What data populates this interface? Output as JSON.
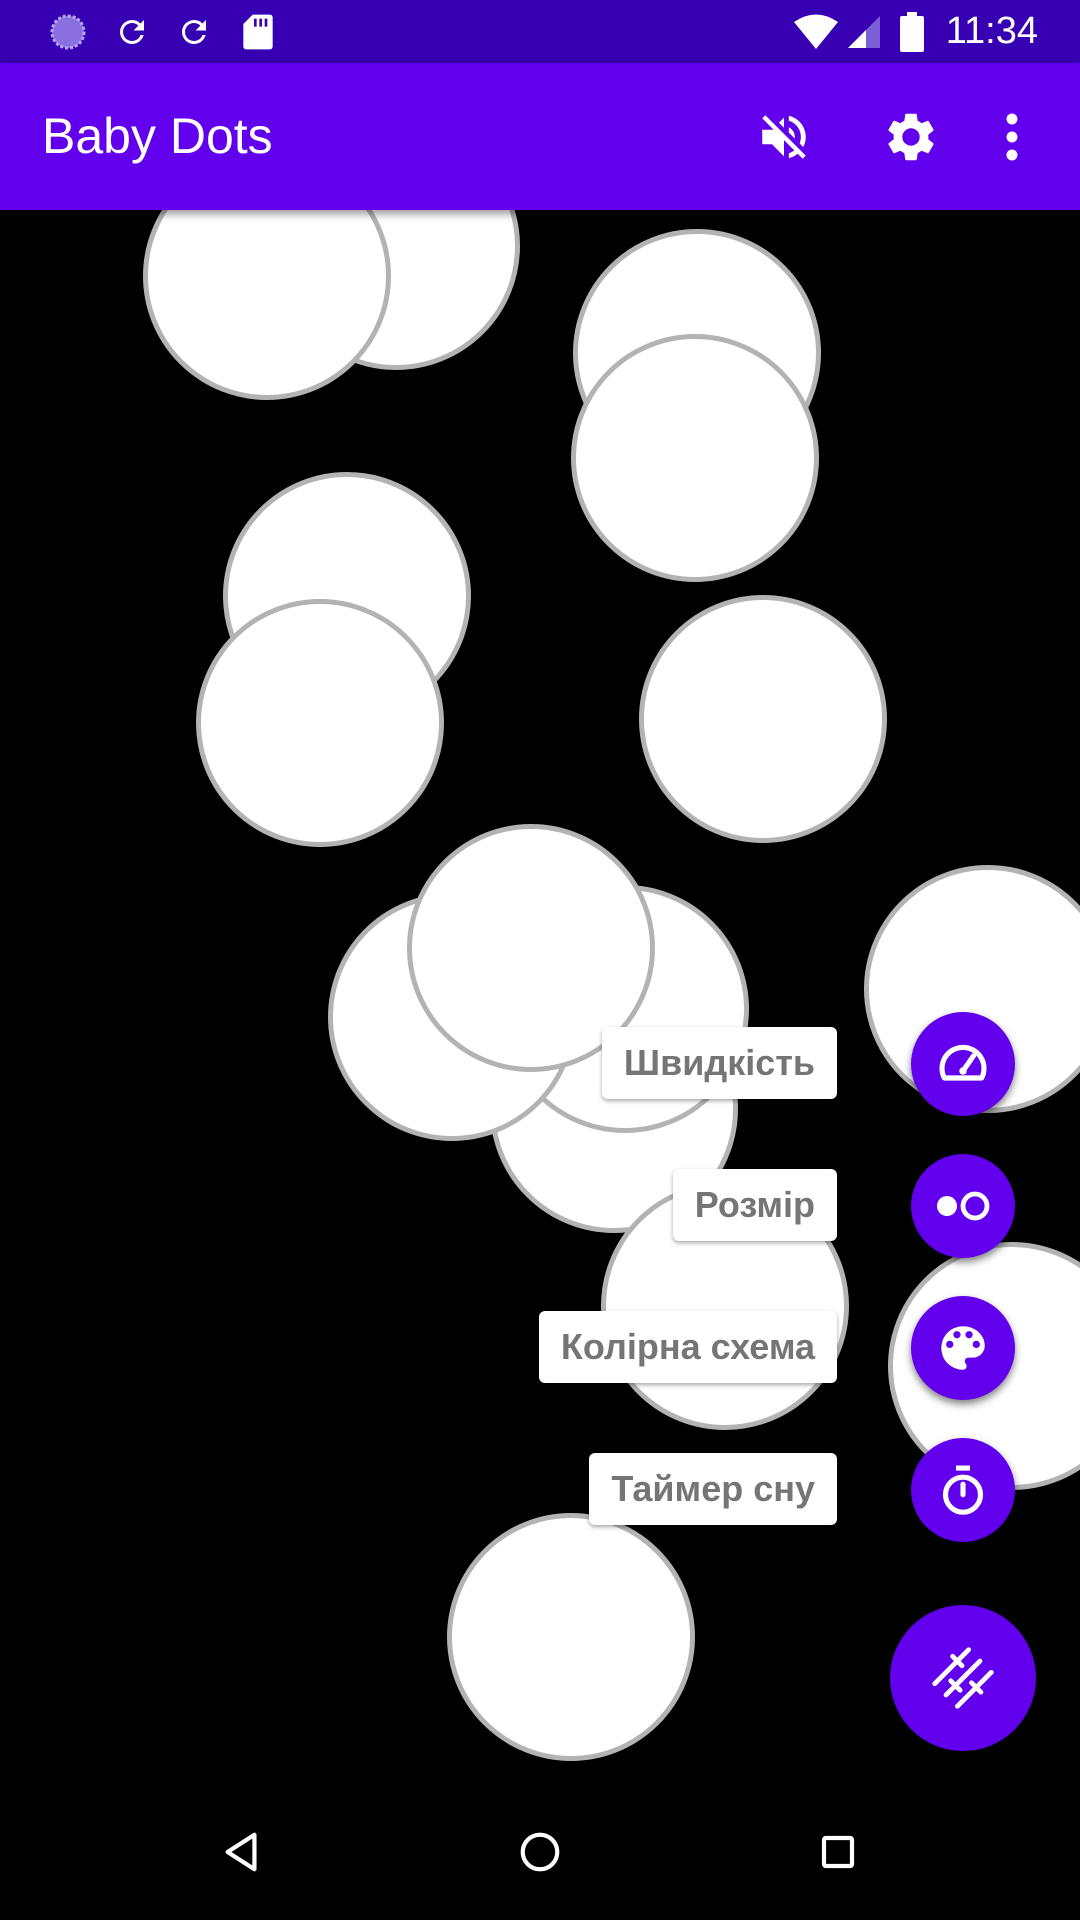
{
  "status_bar": {
    "time": "11:34",
    "icons": [
      "loading-spinner-icon",
      "sync-icon",
      "sync-icon",
      "sd-card-icon",
      "wifi-icon",
      "signal-icon",
      "battery-icon"
    ]
  },
  "app_bar": {
    "title": "Baby Dots",
    "actions": [
      "volume-off-icon",
      "gear-icon",
      "overflow-menu-icon"
    ]
  },
  "menu": {
    "speed_label": "Швидкість",
    "size_label": "Розмір",
    "color_scheme_label": "Колірна схема",
    "sleep_timer_label": "Таймер сну"
  },
  "colors": {
    "status_bar": "#3700b3",
    "app_bar": "#6200ee",
    "fab": "#6200ee",
    "dot_fill": "#ffffff",
    "dot_border": "#b3b3b3",
    "background": "#000000"
  },
  "navigation": [
    "back-icon",
    "home-icon",
    "recents-icon"
  ]
}
